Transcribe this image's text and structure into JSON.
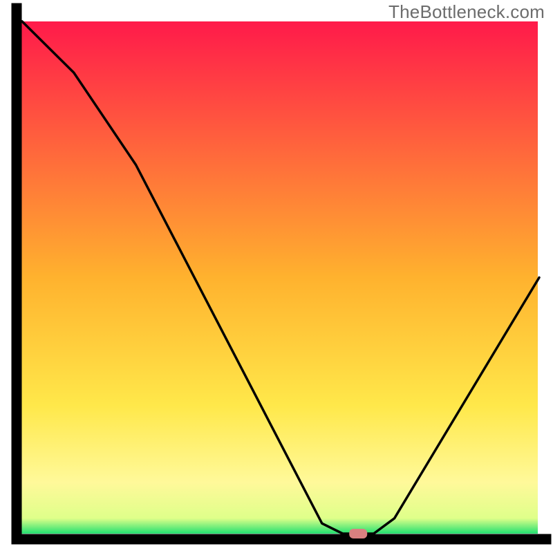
{
  "watermark": "TheBottleneck.com",
  "chart_data": {
    "type": "line",
    "title": "",
    "xlabel": "",
    "ylabel": "",
    "xlim": [
      0,
      100
    ],
    "ylim": [
      0,
      100
    ],
    "grid": false,
    "legend": false,
    "background_gradient_stops": [
      {
        "offset": 0,
        "color": "#ff1a4a"
      },
      {
        "offset": 0.5,
        "color": "#ffb22e"
      },
      {
        "offset": 0.75,
        "color": "#ffe84a"
      },
      {
        "offset": 0.9,
        "color": "#fff99a"
      },
      {
        "offset": 0.97,
        "color": "#dfff8a"
      },
      {
        "offset": 1.0,
        "color": "#22e070"
      }
    ],
    "series": [
      {
        "name": "bottleneck-curve",
        "color": "#000000",
        "x": [
          0,
          10,
          22,
          58,
          62,
          68,
          72,
          100
        ],
        "y": [
          100,
          90,
          72,
          2,
          0,
          0,
          3,
          50
        ]
      }
    ],
    "marker": {
      "name": "optimal-point",
      "x": 65,
      "y": 0,
      "color": "#d98080"
    }
  }
}
